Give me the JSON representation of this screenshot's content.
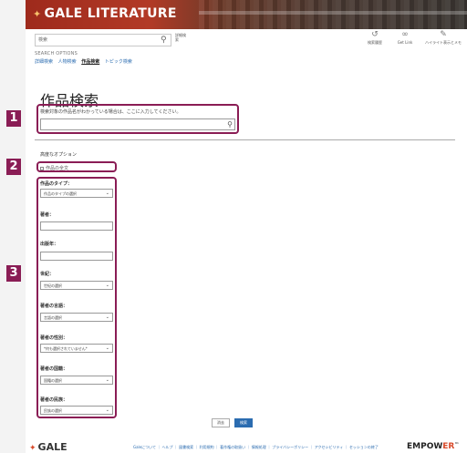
{
  "header": {
    "logo_text": "GALE LITERATURE"
  },
  "search": {
    "placeholder": "検索",
    "advanced_link": "詳細検索"
  },
  "tools": [
    {
      "label": "検索履歴",
      "icon": "history-icon"
    },
    {
      "label": "Get Link",
      "icon": "link-icon"
    },
    {
      "label": "ハイライト表示とメモ",
      "icon": "pencil-icon"
    }
  ],
  "search_options": {
    "label": "SEARCH OPTIONS",
    "tabs": [
      "詳細検索",
      "人物検索",
      "作品検索",
      "トピック検索"
    ],
    "active_tab": "作品検索"
  },
  "main": {
    "title": "作品検索",
    "hint": "検索対象の作品名がわかっている場合は、ここに入力してください。",
    "options_heading": "高度なオプション",
    "fulltext_label": "作品の全文"
  },
  "fields": [
    {
      "label": "作品のタイプ：",
      "kind": "select",
      "value": "作品のタイプの選択"
    },
    {
      "label": "著者：",
      "kind": "text",
      "value": ""
    },
    {
      "label": "出版年：",
      "kind": "text",
      "value": ""
    },
    {
      "label": "世紀：",
      "kind": "select",
      "value": "世紀の選択"
    },
    {
      "label": "著者の言語：",
      "kind": "select",
      "value": "言語の選択"
    },
    {
      "label": "著者の性別：",
      "kind": "select",
      "value": "*何も選択されていません*"
    },
    {
      "label": "著者の国籍：",
      "kind": "select",
      "value": "国籍の選択"
    },
    {
      "label": "著者の民族：",
      "kind": "select",
      "value": "民族の選択"
    }
  ],
  "buttons": {
    "clear": "消去",
    "search": "検索"
  },
  "footer": {
    "gale": "GALE",
    "links": "Galeについて ｜ ヘルプ ｜ 図書検索 ｜ 利用規約 ｜ 著作権の取扱い ｜ 情報処理 ｜ プライバシーポリシー ｜ アクセシビリティ ｜ セッションの終了",
    "empower_a": "EMPOW",
    "empower_b": "ER",
    "empower_tm": "™"
  },
  "markers": [
    "1",
    "2",
    "3"
  ],
  "colors": {
    "marker": "#8a1d55",
    "header_red": "#b23a26",
    "link_blue": "#2b6cb0"
  }
}
